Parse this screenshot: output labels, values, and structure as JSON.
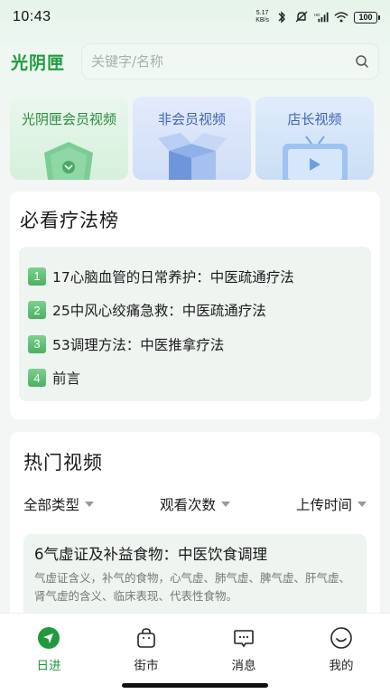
{
  "status_bar": {
    "time": "10:43",
    "net_speed_value": "5.17",
    "net_speed_unit": "KB/s",
    "signal_label": "HD",
    "battery": "100"
  },
  "header": {
    "title": "光阴匣",
    "search_placeholder": "关键字/名称"
  },
  "categories": [
    {
      "label": "光阴匣会员视频"
    },
    {
      "label": "非会员视频"
    },
    {
      "label": "店长视频"
    }
  ],
  "ranking": {
    "title": "必看疗法榜",
    "items": [
      {
        "num": "1",
        "text": "17心脑血管的日常养护：中医疏通疗法"
      },
      {
        "num": "2",
        "text": "25中风心绞痛急救：中医疏通疗法"
      },
      {
        "num": "3",
        "text": "53调理方法：中医推拿疗法"
      },
      {
        "num": "4",
        "text": "前言"
      }
    ]
  },
  "hot_videos": {
    "title": "热门视频",
    "filters": [
      {
        "label": "全部类型"
      },
      {
        "label": "观看次数"
      },
      {
        "label": "上传时间"
      }
    ],
    "video": {
      "title": "6气虚证及补益食物：中医饮食调理",
      "desc": "气虚证含义，补气的食物，心气虚、肺气虚、脾气虚、肝气虚、肾气虚的含义、临床表现、代表性食物。"
    }
  },
  "bottom_nav": [
    {
      "label": "日进",
      "icon": "compass-icon",
      "active": true
    },
    {
      "label": "街市",
      "icon": "shopping-bag-icon",
      "active": false
    },
    {
      "label": "消息",
      "icon": "message-icon",
      "active": false
    },
    {
      "label": "我的",
      "icon": "smiley-icon",
      "active": false
    }
  ],
  "colors": {
    "brand": "#1f9a3d",
    "rank_badge": "#5bbb6e",
    "member_text": "#2a8b3f",
    "nonmember_text": "#3c66b4"
  }
}
